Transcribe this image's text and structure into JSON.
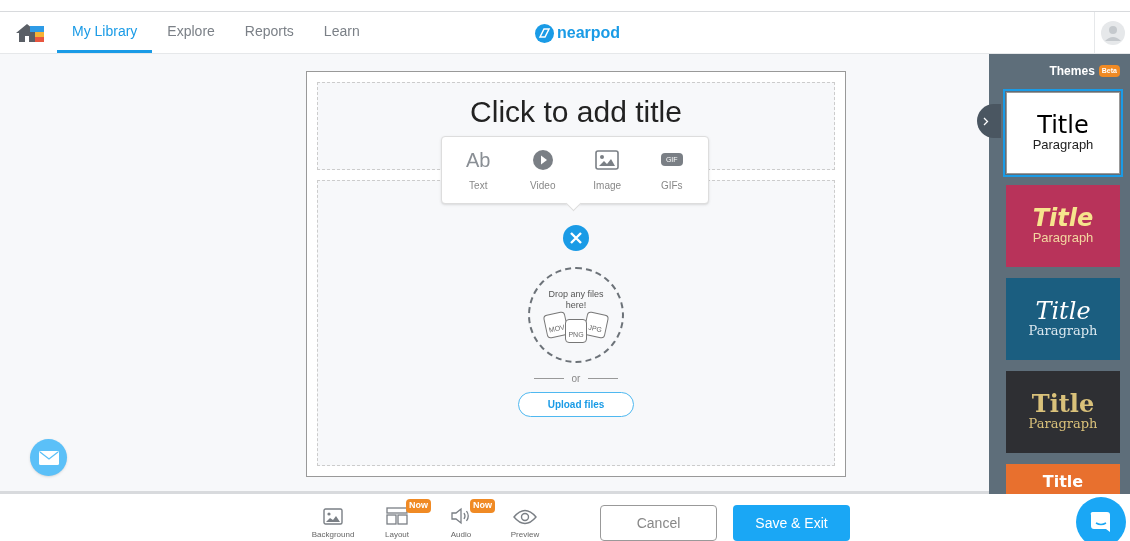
{
  "nav": {
    "tabs": [
      {
        "label": "My Library",
        "selected": true
      },
      {
        "label": "Explore",
        "selected": false
      },
      {
        "label": "Reports",
        "selected": false
      },
      {
        "label": "Learn",
        "selected": false
      }
    ],
    "logo": "nearpod"
  },
  "slide": {
    "title_placeholder": "Click to add title",
    "insert_menu": [
      {
        "kind": "text",
        "label": "Text",
        "glyph": "Ab"
      },
      {
        "kind": "video",
        "label": "Video"
      },
      {
        "kind": "image",
        "label": "Image"
      },
      {
        "kind": "gif",
        "label": "GIFs",
        "glyph": "GIF"
      }
    ],
    "drop_text": "Drop any files here!",
    "file_types": [
      "MOV",
      "PNG",
      "JPG"
    ],
    "or": "or",
    "upload": "Upload files"
  },
  "themes": {
    "title": "Themes",
    "badge": "Beta",
    "items": [
      {
        "kind": "plain",
        "title": "Title",
        "paragraph": "Paragraph",
        "color": "#ffffff",
        "selected": true
      },
      {
        "kind": "italic",
        "title": "Title",
        "paragraph": "Paragraph",
        "color": "#b8335a",
        "selected": false
      },
      {
        "kind": "serif-italic",
        "title": "Title",
        "paragraph": "Paragraph",
        "color": "#1b5e80",
        "selected": false
      },
      {
        "kind": "serif",
        "title": "Title",
        "paragraph": "Paragraph",
        "color": "#2e2f33",
        "selected": false
      },
      {
        "kind": "plain-cut",
        "title": "Title",
        "color": "#e8702e",
        "selected": false
      }
    ]
  },
  "toolbar": [
    {
      "kind": "background",
      "label": "Background"
    },
    {
      "kind": "layout",
      "label": "Layout",
      "badge": "Now"
    },
    {
      "kind": "audio",
      "label": "Audio",
      "badge": "Now"
    },
    {
      "kind": "preview",
      "label": "Preview"
    }
  ],
  "buttons": {
    "cancel": "Cancel",
    "save": "Save & Exit"
  }
}
